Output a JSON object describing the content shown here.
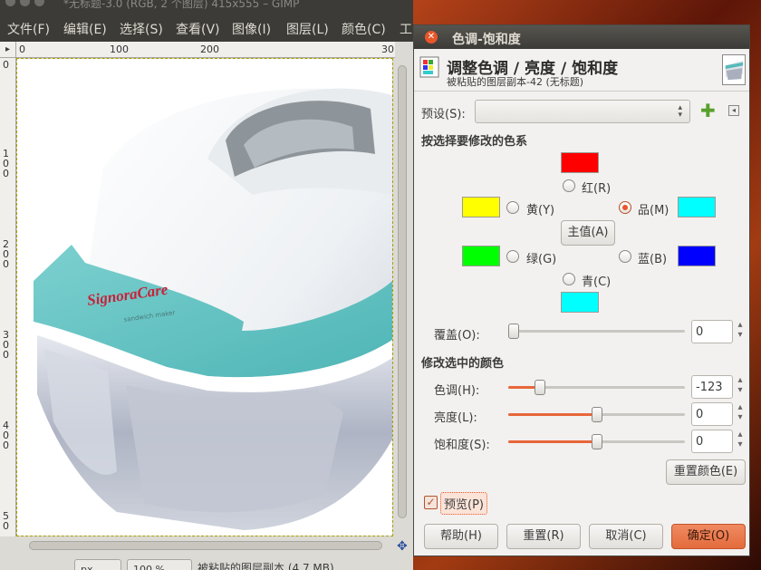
{
  "gimp_window": {
    "title": "*无标题-3.0 (RGB, 2 个图层) 415x555 – GIMP",
    "menu": [
      "文件(F)",
      "编辑(E)",
      "选择(S)",
      "查看(V)",
      "图像(I)",
      "图层(L)",
      "颜色(C)",
      "工"
    ],
    "ruler_h": [
      "0",
      "100",
      "200",
      "30"
    ],
    "ruler_v": [
      "0",
      "1\n0\n0",
      "2\n0\n0",
      "3\n0\n0",
      "4\n0\n0",
      "5\n0"
    ],
    "canvas_logo": "SignoraCare",
    "canvas_logo_sub": "sandwich maker",
    "status": {
      "unit": "px",
      "zoom": "100 %",
      "text": "被粘贴的图层副本 (4.7 MB)"
    }
  },
  "dialog": {
    "title": "色调-饱和度",
    "heading": "调整色调 / 亮度 / 饱和度",
    "subheading": "被粘贴的图层副本-42 (无标题)",
    "preset_label": "预设(S):",
    "preset_value": "",
    "section_select": "按选择要修改的色系",
    "colors": {
      "red": {
        "label": "红(R)",
        "hex": "#ff0000"
      },
      "yellow": {
        "label": "黄(Y)",
        "hex": "#ffff00"
      },
      "magenta": {
        "label": "品(M)",
        "hex": "#00ffff",
        "selected": true
      },
      "green": {
        "label": "绿(G)",
        "hex": "#00ff00"
      },
      "blue": {
        "label": "蓝(B)",
        "hex": "#0000ff"
      },
      "cyan": {
        "label": "青(C)",
        "hex": "#00ffff"
      }
    },
    "master_button": "主值(A)",
    "overlap": {
      "label": "覆盖(O):",
      "value": "0",
      "fraction": 0.0
    },
    "section_modify": "修改选中的颜色",
    "hue": {
      "label": "色调(H):",
      "value": "-123",
      "fraction": 0.158
    },
    "lightness": {
      "label": "亮度(L):",
      "value": "0",
      "fraction": 0.5
    },
    "saturation": {
      "label": "饱和度(S):",
      "value": "0",
      "fraction": 0.5
    },
    "reset_color_button": "重置颜色(E)",
    "preview": {
      "label": "预览(P)",
      "checked": true
    },
    "buttons": {
      "help": "帮助(H)",
      "reset": "重置(R)",
      "cancel": "取消(C)",
      "ok": "确定(O)"
    }
  },
  "accent_color": "#e8562a"
}
